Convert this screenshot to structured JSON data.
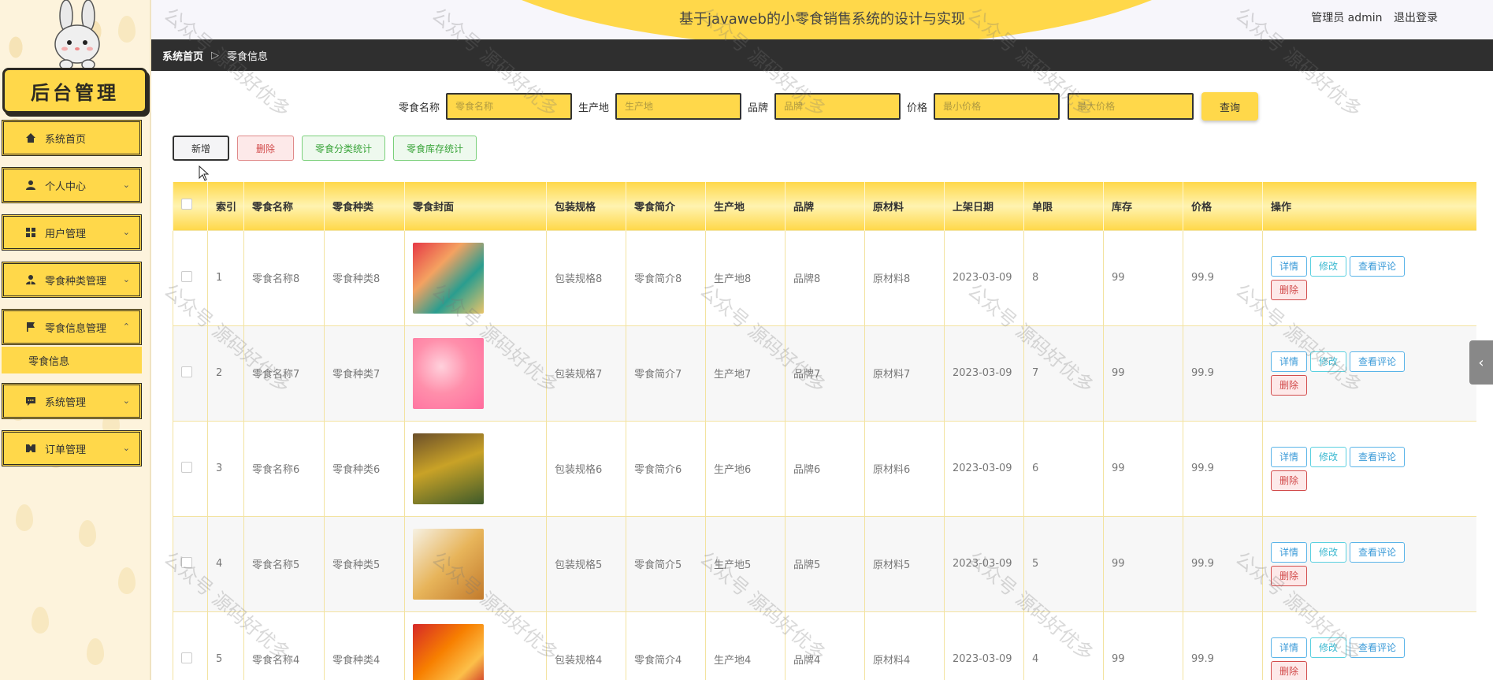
{
  "header": {
    "title": "基于javaweb的小零食销售系统的设计与实现",
    "user_label": "管理员 admin",
    "logout_label": "退出登录"
  },
  "sidebar": {
    "logo_text": "后台管理",
    "items": [
      {
        "label": "系统首页",
        "icon": "home-icon"
      },
      {
        "label": "个人中心",
        "icon": "user-icon"
      },
      {
        "label": "用户管理",
        "icon": "grid-icon"
      },
      {
        "label": "零食种类管理",
        "icon": "user-tie-icon"
      },
      {
        "label": "零食信息管理",
        "icon": "flag-icon"
      },
      {
        "label": "系统管理",
        "icon": "chat-icon"
      },
      {
        "label": "订单管理",
        "icon": "orders-icon"
      }
    ],
    "submenu_active": "零食信息"
  },
  "breadcrumb": {
    "home": "系统首页",
    "current": "零食信息"
  },
  "search": {
    "name_label": "零食名称",
    "name_placeholder": "零食名称",
    "origin_label": "生产地",
    "origin_placeholder": "生产地",
    "brand_label": "品牌",
    "brand_placeholder": "品牌",
    "price_label": "价格",
    "min_placeholder": "最小价格",
    "max_placeholder": "最大价格",
    "query_label": "查询"
  },
  "actions": {
    "add": "新增",
    "delete": "删除",
    "category_stats": "零食分类统计",
    "stock_stats": "零食库存统计"
  },
  "table": {
    "headers": [
      "索引",
      "零食名称",
      "零食种类",
      "零食封面",
      "包装规格",
      "零食简介",
      "生产地",
      "品牌",
      "原材料",
      "上架日期",
      "单限",
      "库存",
      "价格",
      "操作"
    ],
    "ops": {
      "detail": "详情",
      "edit": "修改",
      "review": "查看评论",
      "delete": "删除"
    },
    "rows": [
      {
        "idx": "1",
        "name": "零食名称8",
        "type": "零食种类8",
        "spec": "包装规格8",
        "intro": "零食简介8",
        "origin": "生产地8",
        "brand": "品牌8",
        "material": "原材料8",
        "date": "2023-03-09",
        "limit": "8",
        "stock": "99",
        "price": "99.9"
      },
      {
        "idx": "2",
        "name": "零食名称7",
        "type": "零食种类7",
        "spec": "包装规格7",
        "intro": "零食简介7",
        "origin": "生产地7",
        "brand": "品牌7",
        "material": "原材料7",
        "date": "2023-03-09",
        "limit": "7",
        "stock": "99",
        "price": "99.9"
      },
      {
        "idx": "3",
        "name": "零食名称6",
        "type": "零食种类6",
        "spec": "包装规格6",
        "intro": "零食简介6",
        "origin": "生产地6",
        "brand": "品牌6",
        "material": "原材料6",
        "date": "2023-03-09",
        "limit": "6",
        "stock": "99",
        "price": "99.9"
      },
      {
        "idx": "4",
        "name": "零食名称5",
        "type": "零食种类5",
        "spec": "包装规格5",
        "intro": "零食简介5",
        "origin": "生产地5",
        "brand": "品牌5",
        "material": "原材料5",
        "date": "2023-03-09",
        "limit": "5",
        "stock": "99",
        "price": "99.9"
      },
      {
        "idx": "5",
        "name": "零食名称4",
        "type": "零食种类4",
        "spec": "包装规格4",
        "intro": "零食简介4",
        "origin": "生产地4",
        "brand": "品牌4",
        "material": "原材料4",
        "date": "2023-03-09",
        "limit": "4",
        "stock": "99",
        "price": "99.9"
      }
    ]
  },
  "watermark_text": "公众号 源码好优多",
  "colors": {
    "accent": "#ffd84a",
    "dark": "#2f2f2f",
    "danger": "#d24c4c",
    "info": "#3a9ad8",
    "success": "#3aa43a"
  }
}
